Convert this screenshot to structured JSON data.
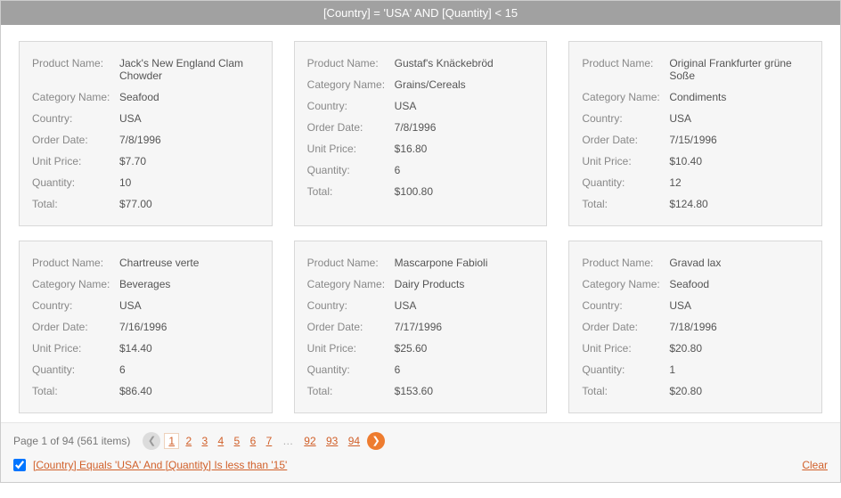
{
  "header": {
    "title": "[Country] = 'USA' AND [Quantity] < 15"
  },
  "labels": {
    "product_name": "Product Name:",
    "category_name": "Category Name:",
    "country": "Country:",
    "order_date": "Order Date:",
    "unit_price": "Unit Price:",
    "quantity": "Quantity:",
    "total": "Total:"
  },
  "cards": [
    {
      "product_name": "Jack's New England Clam Chowder",
      "category_name": "Seafood",
      "country": "USA",
      "order_date": "7/8/1996",
      "unit_price": "$7.70",
      "quantity": "10",
      "total": "$77.00"
    },
    {
      "product_name": "Gustaf's Knäckebröd",
      "category_name": "Grains/Cereals",
      "country": "USA",
      "order_date": "7/8/1996",
      "unit_price": "$16.80",
      "quantity": "6",
      "total": "$100.80"
    },
    {
      "product_name": "Original Frankfurter grüne Soße",
      "category_name": "Condiments",
      "country": "USA",
      "order_date": "7/15/1996",
      "unit_price": "$10.40",
      "quantity": "12",
      "total": "$124.80"
    },
    {
      "product_name": "Chartreuse verte",
      "category_name": "Beverages",
      "country": "USA",
      "order_date": "7/16/1996",
      "unit_price": "$14.40",
      "quantity": "6",
      "total": "$86.40"
    },
    {
      "product_name": "Mascarpone Fabioli",
      "category_name": "Dairy Products",
      "country": "USA",
      "order_date": "7/17/1996",
      "unit_price": "$25.60",
      "quantity": "6",
      "total": "$153.60"
    },
    {
      "product_name": "Gravad lax",
      "category_name": "Seafood",
      "country": "USA",
      "order_date": "7/18/1996",
      "unit_price": "$20.80",
      "quantity": "1",
      "total": "$20.80"
    }
  ],
  "pager": {
    "summary": "Page 1 of 94 (561 items)",
    "pages_left": [
      "1",
      "2",
      "3",
      "4",
      "5",
      "6",
      "7"
    ],
    "pages_right": [
      "92",
      "93",
      "94"
    ],
    "ellipsis": "…"
  },
  "filter": {
    "text": "[Country] Equals 'USA' And [Quantity] Is less than '15'",
    "clear": "Clear"
  }
}
